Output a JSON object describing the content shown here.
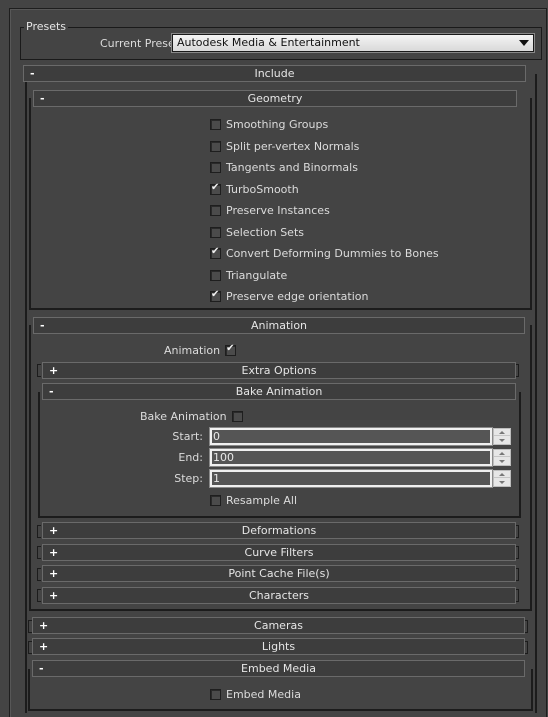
{
  "presets": {
    "group_label": "Presets",
    "current_preset_label": "Current Preset:",
    "current_preset_value": "Autodesk Media & Entertainment"
  },
  "rollouts": {
    "include": {
      "title": "Include",
      "sign": "-"
    },
    "geometry": {
      "title": "Geometry",
      "sign": "-",
      "options": [
        {
          "label": "Smoothing Groups",
          "checked": false
        },
        {
          "label": "Split per-vertex Normals",
          "checked": false
        },
        {
          "label": "Tangents and Binormals",
          "checked": false
        },
        {
          "label": "TurboSmooth",
          "checked": true
        },
        {
          "label": "Preserve Instances",
          "checked": false
        },
        {
          "label": "Selection Sets",
          "checked": false
        },
        {
          "label": "Convert Deforming Dummies to Bones",
          "checked": true
        },
        {
          "label": "Triangulate",
          "checked": false
        },
        {
          "label": "Preserve edge orientation",
          "checked": true
        }
      ]
    },
    "animation": {
      "title": "Animation",
      "sign": "-",
      "toggle_label": "Animation",
      "toggle_checked": true,
      "extra_options": {
        "title": "Extra Options",
        "sign": "+"
      },
      "bake_animation": {
        "title": "Bake Animation",
        "sign": "-",
        "toggle_label": "Bake Animation",
        "toggle_checked": false,
        "start_label": "Start:",
        "start_value": "0",
        "end_label": "End:",
        "end_value": "100",
        "step_label": "Step:",
        "step_value": "1",
        "resample_label": "Resample All",
        "resample_checked": false
      },
      "deformations": {
        "title": "Deformations",
        "sign": "+"
      },
      "curve_filters": {
        "title": "Curve Filters",
        "sign": "+"
      },
      "point_cache": {
        "title": "Point Cache File(s)",
        "sign": "+"
      },
      "characters": {
        "title": "Characters",
        "sign": "+"
      }
    },
    "cameras": {
      "title": "Cameras",
      "sign": "+"
    },
    "lights": {
      "title": "Lights",
      "sign": "+"
    },
    "embed_media": {
      "title": "Embed Media",
      "sign": "-",
      "toggle_label": "Embed Media",
      "toggle_checked": false
    }
  }
}
